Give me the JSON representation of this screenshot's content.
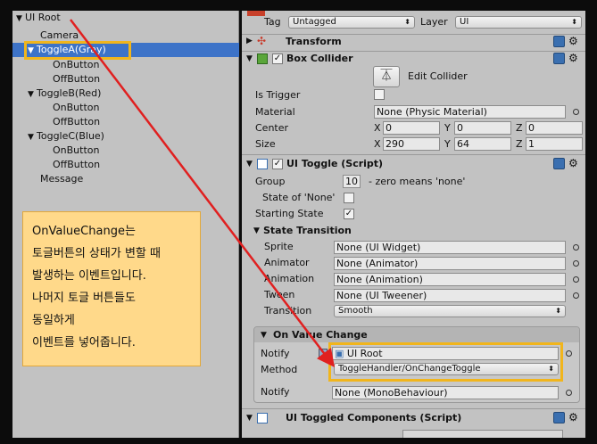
{
  "hierarchy": {
    "items": [
      {
        "label": "UI Root",
        "expander": "▼"
      },
      {
        "label": "Camera",
        "expander": ""
      },
      {
        "label": "ToggleA(Gray)",
        "expander": "▼"
      },
      {
        "label": "OnButton",
        "expander": ""
      },
      {
        "label": "OffButton",
        "expander": ""
      },
      {
        "label": "ToggleB(Red)",
        "expander": "▼"
      },
      {
        "label": "OnButton",
        "expander": ""
      },
      {
        "label": "OffButton",
        "expander": ""
      },
      {
        "label": "ToggleC(Blue)",
        "expander": "▼"
      },
      {
        "label": "OnButton",
        "expander": ""
      },
      {
        "label": "OffButton",
        "expander": ""
      },
      {
        "label": "Message",
        "expander": ""
      }
    ],
    "selected_index": 2
  },
  "note": {
    "lines": [
      "OnValueChange는",
      "토글버튼의 상태가 변할 때",
      "발생하는 이벤트입니다.",
      "나머지 토글 버튼들도",
      "동일하게",
      "이벤트를 넣어줍니다."
    ]
  },
  "inspector": {
    "tag_label": "Tag",
    "tag_value": "Untagged",
    "layer_label": "Layer",
    "layer_value": "UI",
    "transform": {
      "title": "Transform"
    },
    "box_collider": {
      "title": "Box Collider",
      "edit_collider": "Edit Collider",
      "is_trigger": "Is Trigger",
      "material_label": "Material",
      "material_value": "None (Physic Material)",
      "center_label": "Center",
      "center": {
        "x": "0",
        "y": "0",
        "z": "0"
      },
      "size_label": "Size",
      "size": {
        "x": "290",
        "y": "64",
        "z": "1"
      },
      "axis_x": "X",
      "axis_y": "Y",
      "axis_z": "Z"
    },
    "ui_toggle": {
      "title": "UI Toggle (Script)",
      "group_label": "Group",
      "group_value": "10",
      "group_hint": "- zero means 'none'",
      "state_none_label": "State of 'None'",
      "starting_state_label": "Starting State",
      "state_transition": "State Transition",
      "sprite_label": "Sprite",
      "sprite_value": "None (UI Widget)",
      "animator_label": "Animator",
      "animator_value": "None (Animator)",
      "animation_label": "Animation",
      "animation_value": "None (Animation)",
      "tween_label": "Tween",
      "tween_value": "None (UI Tweener)",
      "transition_label": "Transition",
      "transition_value": "Smooth",
      "on_value_change": "On Value Change",
      "notify_label": "Notify",
      "notify_value": "UI Root",
      "method_label": "Method",
      "method_value": "ToggleHandler/OnChangeToggle",
      "notify2_label": "Notify",
      "notify2_value": "None (MonoBehaviour)"
    },
    "toggled_components": {
      "title": "UI Toggled Components (Script)"
    }
  },
  "colors": {
    "highlight": "#f1b51c",
    "arrow": "#e02020",
    "note_bg": "#ffd98a",
    "selection": "#3d73c8"
  }
}
